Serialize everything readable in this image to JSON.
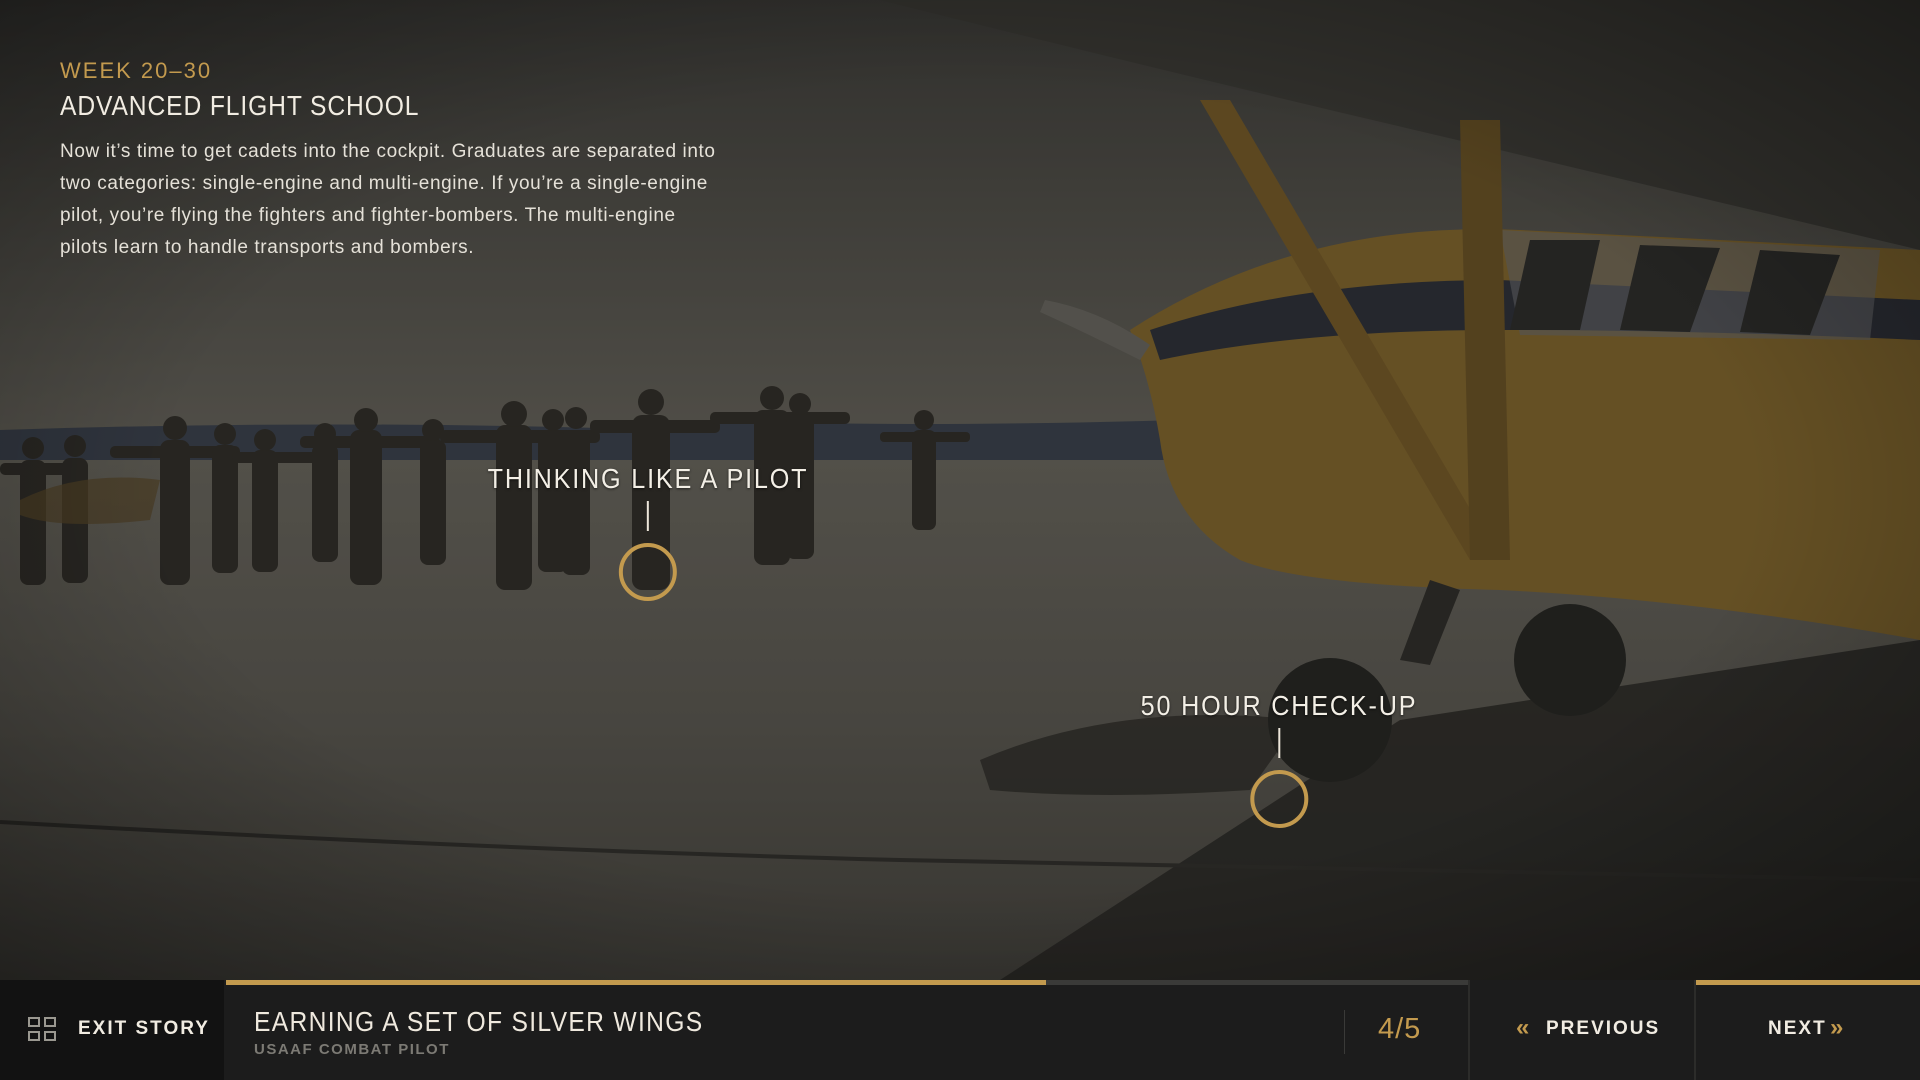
{
  "intro": {
    "week": "WEEK 20–30",
    "title": "ADVANCED FLIGHT SCHOOL",
    "body": "Now it’s time to get cadets into the cockpit. Graduates are separated into two categories: single-engine and multi-engine. If you’re a single-engine pilot, you’re flying the fighters and fighter-bombers. The multi-engine pilots learn to handle transports and bombers."
  },
  "hotspots": [
    {
      "label": "THINKING LIKE A PILOT"
    },
    {
      "label": "50 HOUR CHECK-UP"
    }
  ],
  "footer": {
    "exit_label": "EXIT STORY",
    "story_title": "EARNING A SET OF SILVER WINGS",
    "story_subtitle": "USAAF COMBAT PILOT",
    "page_indicator": "4/5",
    "progress": 0.66,
    "previous_label": "PREVIOUS",
    "next_label": "NEXT",
    "previous_icon": "double-chevron-left-icon",
    "next_icon": "double-chevron-right-icon",
    "exit_icon": "grid-icon"
  },
  "colors": {
    "accent": "#c39a4e",
    "bar_background": "#1c1c1c",
    "text": "#f1ece2"
  }
}
